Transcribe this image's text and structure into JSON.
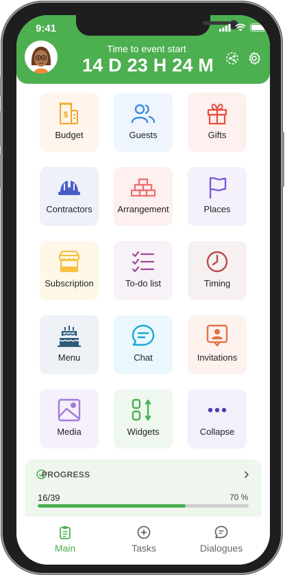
{
  "status_bar": {
    "time": "9:41"
  },
  "header": {
    "event_label": "Time to event start",
    "countdown": "14 D 23 H 24 M"
  },
  "tiles": [
    {
      "label": "Budget",
      "icon": "budget-icon",
      "bg": "#fff5ec",
      "color": "#f5a623"
    },
    {
      "label": "Guests",
      "icon": "guests-icon",
      "bg": "#eef5fd",
      "color": "#3b8be0"
    },
    {
      "label": "Gifts",
      "icon": "gift-icon",
      "bg": "#fdf0ee",
      "color": "#e84c3d"
    },
    {
      "label": "Contractors",
      "icon": "hard-hat-icon",
      "bg": "#eef1f9",
      "color": "#4a5ec9"
    },
    {
      "label": "Arrangement",
      "icon": "bricks-icon",
      "bg": "#fdf0ee",
      "color": "#ef6c6c"
    },
    {
      "label": "Places",
      "icon": "flag-icon",
      "bg": "#f4f1fb",
      "color": "#7d5cd6"
    },
    {
      "label": "Subscription",
      "icon": "shop-icon",
      "bg": "#fff8e8",
      "color": "#f7c242"
    },
    {
      "label": "To-do list",
      "icon": "checklist-icon",
      "bg": "#f8f1f7",
      "color": "#9b4a9a"
    },
    {
      "label": "Timing",
      "icon": "clock-icon",
      "bg": "#f7f0f0",
      "color": "#b84a4a"
    },
    {
      "label": "Menu",
      "icon": "cake-icon",
      "bg": "#eef2f7",
      "color": "#2c5a78"
    },
    {
      "label": "Chat",
      "icon": "chat-icon",
      "bg": "#eaf7fc",
      "color": "#16a9d4"
    },
    {
      "label": "Invitations",
      "icon": "invitation-icon",
      "bg": "#fdf2ee",
      "color": "#e2724a"
    },
    {
      "label": "Media",
      "icon": "image-icon",
      "bg": "#f5f0fb",
      "color": "#a07ad9"
    },
    {
      "label": "Widgets",
      "icon": "widgets-icon",
      "bg": "#eef8ef",
      "color": "#4caf50"
    },
    {
      "label": "Collapse",
      "icon": "more-dots-icon",
      "bg": "#f2f0fa",
      "color": "#4a3fb0"
    }
  ],
  "progress": {
    "title": "PROGRESS",
    "count": "16/39",
    "percent_label": "70 %",
    "percent_value": 70
  },
  "tabs": [
    {
      "label": "Main",
      "icon": "clipboard-icon",
      "active": true
    },
    {
      "label": "Tasks",
      "icon": "plus-circle-icon",
      "active": false
    },
    {
      "label": "Dialogues",
      "icon": "chat-bubble-icon",
      "active": false
    }
  ],
  "colors": {
    "accent": "#4caf50",
    "header": "#4caf50"
  }
}
